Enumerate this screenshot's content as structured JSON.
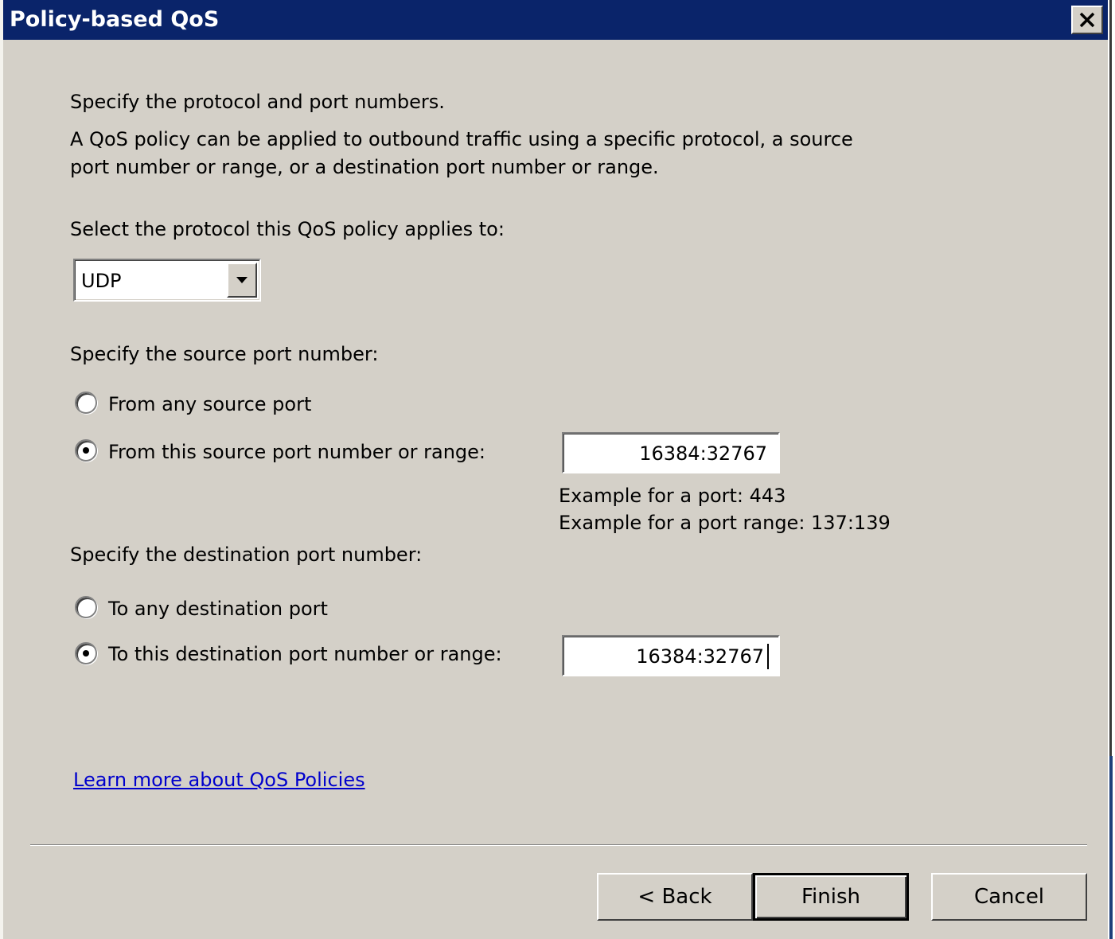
{
  "window": {
    "title": "Policy-based QoS",
    "close_icon": "close-icon"
  },
  "intro": {
    "heading": "Specify the protocol and port numbers.",
    "description_line1": "A QoS policy can be applied to outbound traffic using a specific protocol, a source",
    "description_line2": "port number or range, or a destination port number or range."
  },
  "protocol": {
    "label": "Select the protocol this QoS policy applies to:",
    "selected": "UDP",
    "dropdown_icon": "chevron-down-icon"
  },
  "source": {
    "label": "Specify the source port number:",
    "option_any": "From any source port",
    "option_range": "From this source port number or range:",
    "selected": "range",
    "value": "16384:32767",
    "example_port": "Example for a port: 443",
    "example_range": "Example for a port range: 137:139"
  },
  "destination": {
    "label": "Specify the destination port number:",
    "option_any": "To any destination port",
    "option_range": "To this destination port number or range:",
    "selected": "range",
    "value": "16384:32767"
  },
  "link": {
    "text": "Learn more about QoS Policies"
  },
  "buttons": {
    "back": "< Back",
    "finish": "Finish",
    "cancel": "Cancel"
  },
  "colors": {
    "titlebar": "#0a246a",
    "dialog_bg": "#d4d0c8",
    "link": "#0000cc"
  }
}
